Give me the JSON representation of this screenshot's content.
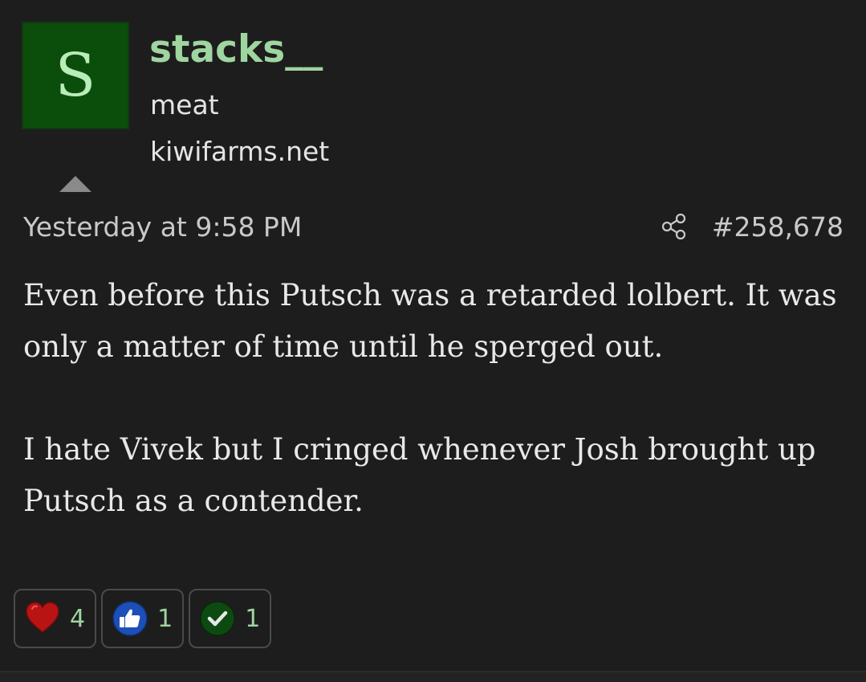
{
  "user": {
    "avatar_letter": "S",
    "avatar_color": "#0b4e0b",
    "name": "stacks__",
    "title": "meat",
    "site": "kiwifarms.net"
  },
  "meta": {
    "timestamp": "Yesterday at 9:58 PM",
    "post_number": "#258,678",
    "share_icon": "share-icon"
  },
  "body": {
    "paragraphs": [
      "Even before this Putsch was a retarded lolbert. It was only a matter of time until he sperged out.",
      "I hate Vivek but I cringed whenever Josh brought up Putsch as a contender."
    ]
  },
  "reactions": [
    {
      "icon": "heart-icon",
      "count": "4",
      "color": "#c01818"
    },
    {
      "icon": "thumbs-up-icon",
      "count": "1",
      "color": "#1d4fb8"
    },
    {
      "icon": "checkmark-icon",
      "count": "1",
      "color": "#0d4a12"
    }
  ],
  "colors": {
    "username": "#9fd59f",
    "background": "#1d1d1e"
  }
}
